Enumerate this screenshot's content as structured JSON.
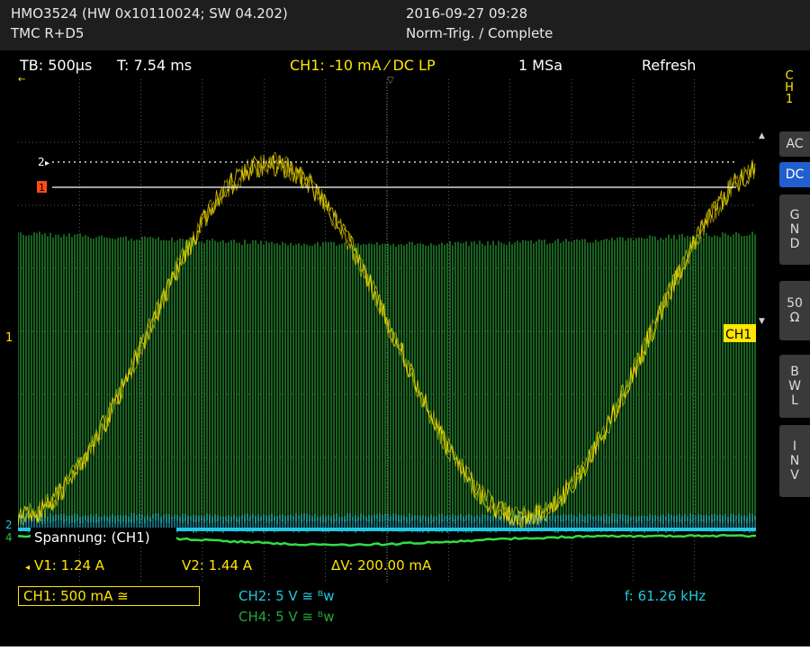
{
  "header": {
    "model": "HMO3524 (HW 0x10110024; SW 04.202)",
    "options": "TMC R+D5",
    "datetime": "2016-09-27 09:28",
    "trigger_state": "Norm-Trig. / Complete"
  },
  "topbar": {
    "timebase": "TB: 500µs",
    "trigger_time": "T: 7.54 ms",
    "trigger_info": "CH1: -10 mA ⁄ DC LP",
    "sample_rate": "1 MSa",
    "mode": "Refresh"
  },
  "side_menu": {
    "channel": [
      "C",
      "H",
      "1"
    ],
    "buttons": [
      {
        "label": "AC",
        "active": false
      },
      {
        "label": "DC",
        "active": true
      },
      {
        "label": "G\nN\nD",
        "active": false
      },
      {
        "label": "50\nΩ",
        "active": false
      },
      {
        "label": "B\nW\nL",
        "active": false
      },
      {
        "label": "I\nN\nV",
        "active": false
      }
    ]
  },
  "markers": {
    "cursor2": "2",
    "trigger1": "1",
    "ch1_right": "CH1",
    "left_ch1": "1",
    "left_ch2": "2",
    "left_ch4": "4"
  },
  "measurement": {
    "title": "Spannung: (CH1)",
    "v1": "V1: 1.24 A",
    "v2": "V2: 1.44 A",
    "dv": "ΔV: 200.00 mA"
  },
  "channels": {
    "ch1": "CH1: 500 mA ≅",
    "ch2": "CH2: 5 V ≅ ᴮᴡ",
    "ch4": "CH4: 5 V ≅ ᴮᴡ",
    "freq": "f: 61.26 kHz"
  },
  "colors": {
    "ch1": "#ffe600",
    "ch2": "#22c8e0",
    "ch4": "#22c040",
    "dark_green": "#1f7a28",
    "grid": "#7a7a7a"
  }
}
